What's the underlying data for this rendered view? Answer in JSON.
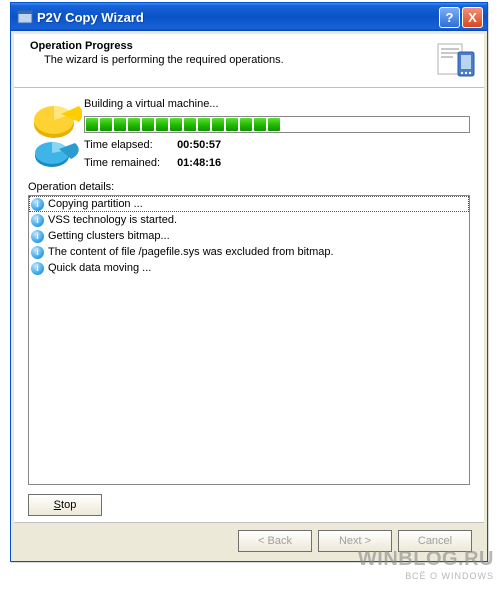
{
  "window": {
    "title": "P2V Copy Wizard",
    "help_glyph": "?",
    "close_glyph": "X"
  },
  "header": {
    "title": "Operation Progress",
    "subtitle": "The wizard is performing the required operations."
  },
  "progress": {
    "status": "Building a virtual machine...",
    "elapsed_label": "Time elapsed:",
    "elapsed_value": "00:50:57",
    "remained_label": "Time remained:",
    "remained_value": "01:48:16"
  },
  "details": {
    "label": "Operation details:",
    "items": [
      "Copying partition ...",
      "VSS technology is started.",
      "Getting clusters bitmap...",
      "The content of file /pagefile.sys was excluded from bitmap.",
      "Quick data moving ..."
    ]
  },
  "buttons": {
    "stop": "Stop",
    "back": "< Back",
    "next": "Next >",
    "cancel": "Cancel"
  },
  "watermark": {
    "line1": "WINBLOG.RU",
    "line2": "ВСЁ О WINDOWS"
  }
}
